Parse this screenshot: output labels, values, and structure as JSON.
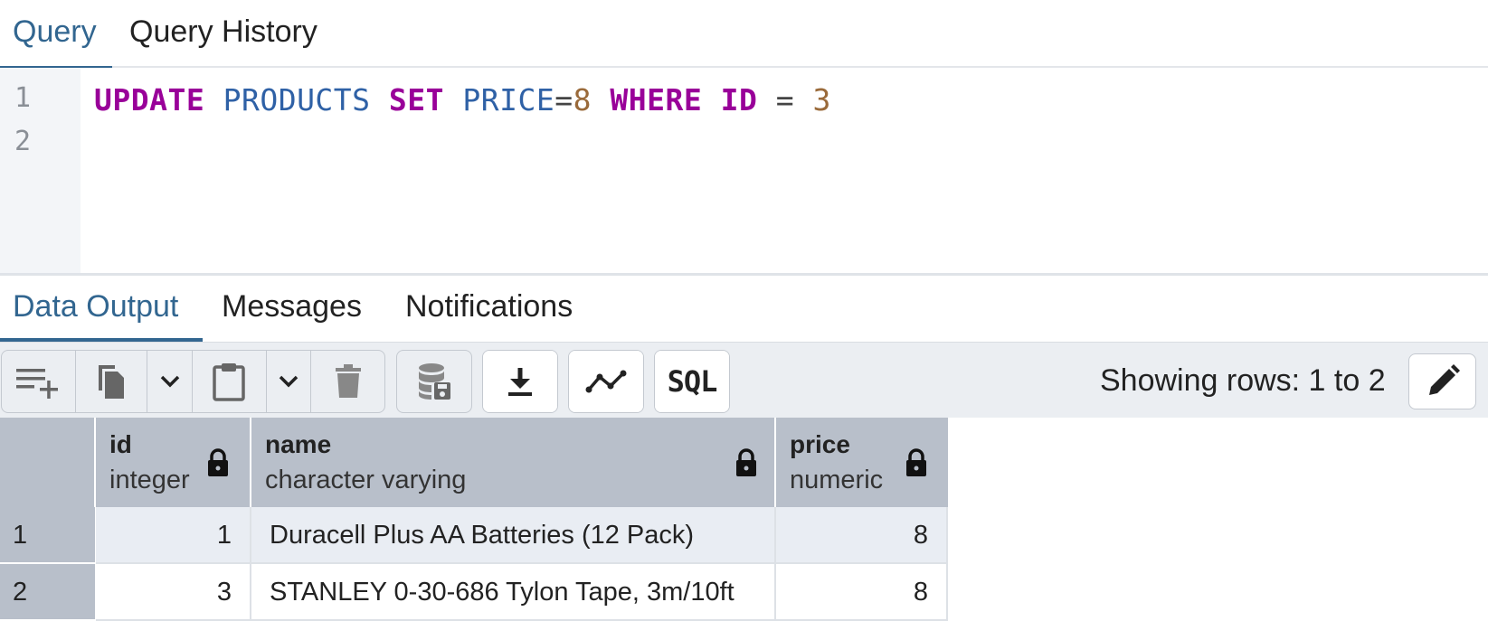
{
  "top_tabs": [
    {
      "label": "Query",
      "active": true
    },
    {
      "label": "Query History",
      "active": false
    }
  ],
  "editor": {
    "line_numbers": [
      "1",
      "2"
    ],
    "code": {
      "t1": "UPDATE",
      "t2": "PRODUCTS",
      "t3": "SET",
      "t4": "PRICE",
      "t5": "=",
      "t6": "8",
      "t7": "WHERE",
      "t8": "ID",
      "t9": "=",
      "t10": "3"
    }
  },
  "bottom_tabs": [
    {
      "label": "Data Output",
      "active": true
    },
    {
      "label": "Messages",
      "active": false
    },
    {
      "label": "Notifications",
      "active": false
    }
  ],
  "toolbar": {
    "buttons": [
      "add-row-icon",
      "copy-icon",
      "chevron-down-icon",
      "paste-icon",
      "chevron-down-icon",
      "delete-icon",
      "save-data-icon",
      "download-icon",
      "graph-icon",
      "sql-icon"
    ],
    "sql_label": "SQL",
    "rows_label": "Showing rows: 1 to 2",
    "edit_icon": "pencil-icon"
  },
  "grid": {
    "columns": [
      {
        "name": "id",
        "type": "integer"
      },
      {
        "name": "name",
        "type": "character varying"
      },
      {
        "name": "price",
        "type": "numeric"
      }
    ],
    "rows": [
      {
        "row_num": "1",
        "id": "1",
        "name": "Duracell Plus AA Batteries (12 Pack)",
        "price": "8"
      },
      {
        "row_num": "2",
        "id": "3",
        "name": "STANLEY 0-30-686 Tylon Tape, 3m/10ft",
        "price": "8"
      }
    ]
  },
  "colors": {
    "accent": "#326690",
    "keyword": "#990099",
    "identifier": "#2f61a6",
    "number": "#9a6a3a",
    "header_bg": "#b8bfca"
  }
}
